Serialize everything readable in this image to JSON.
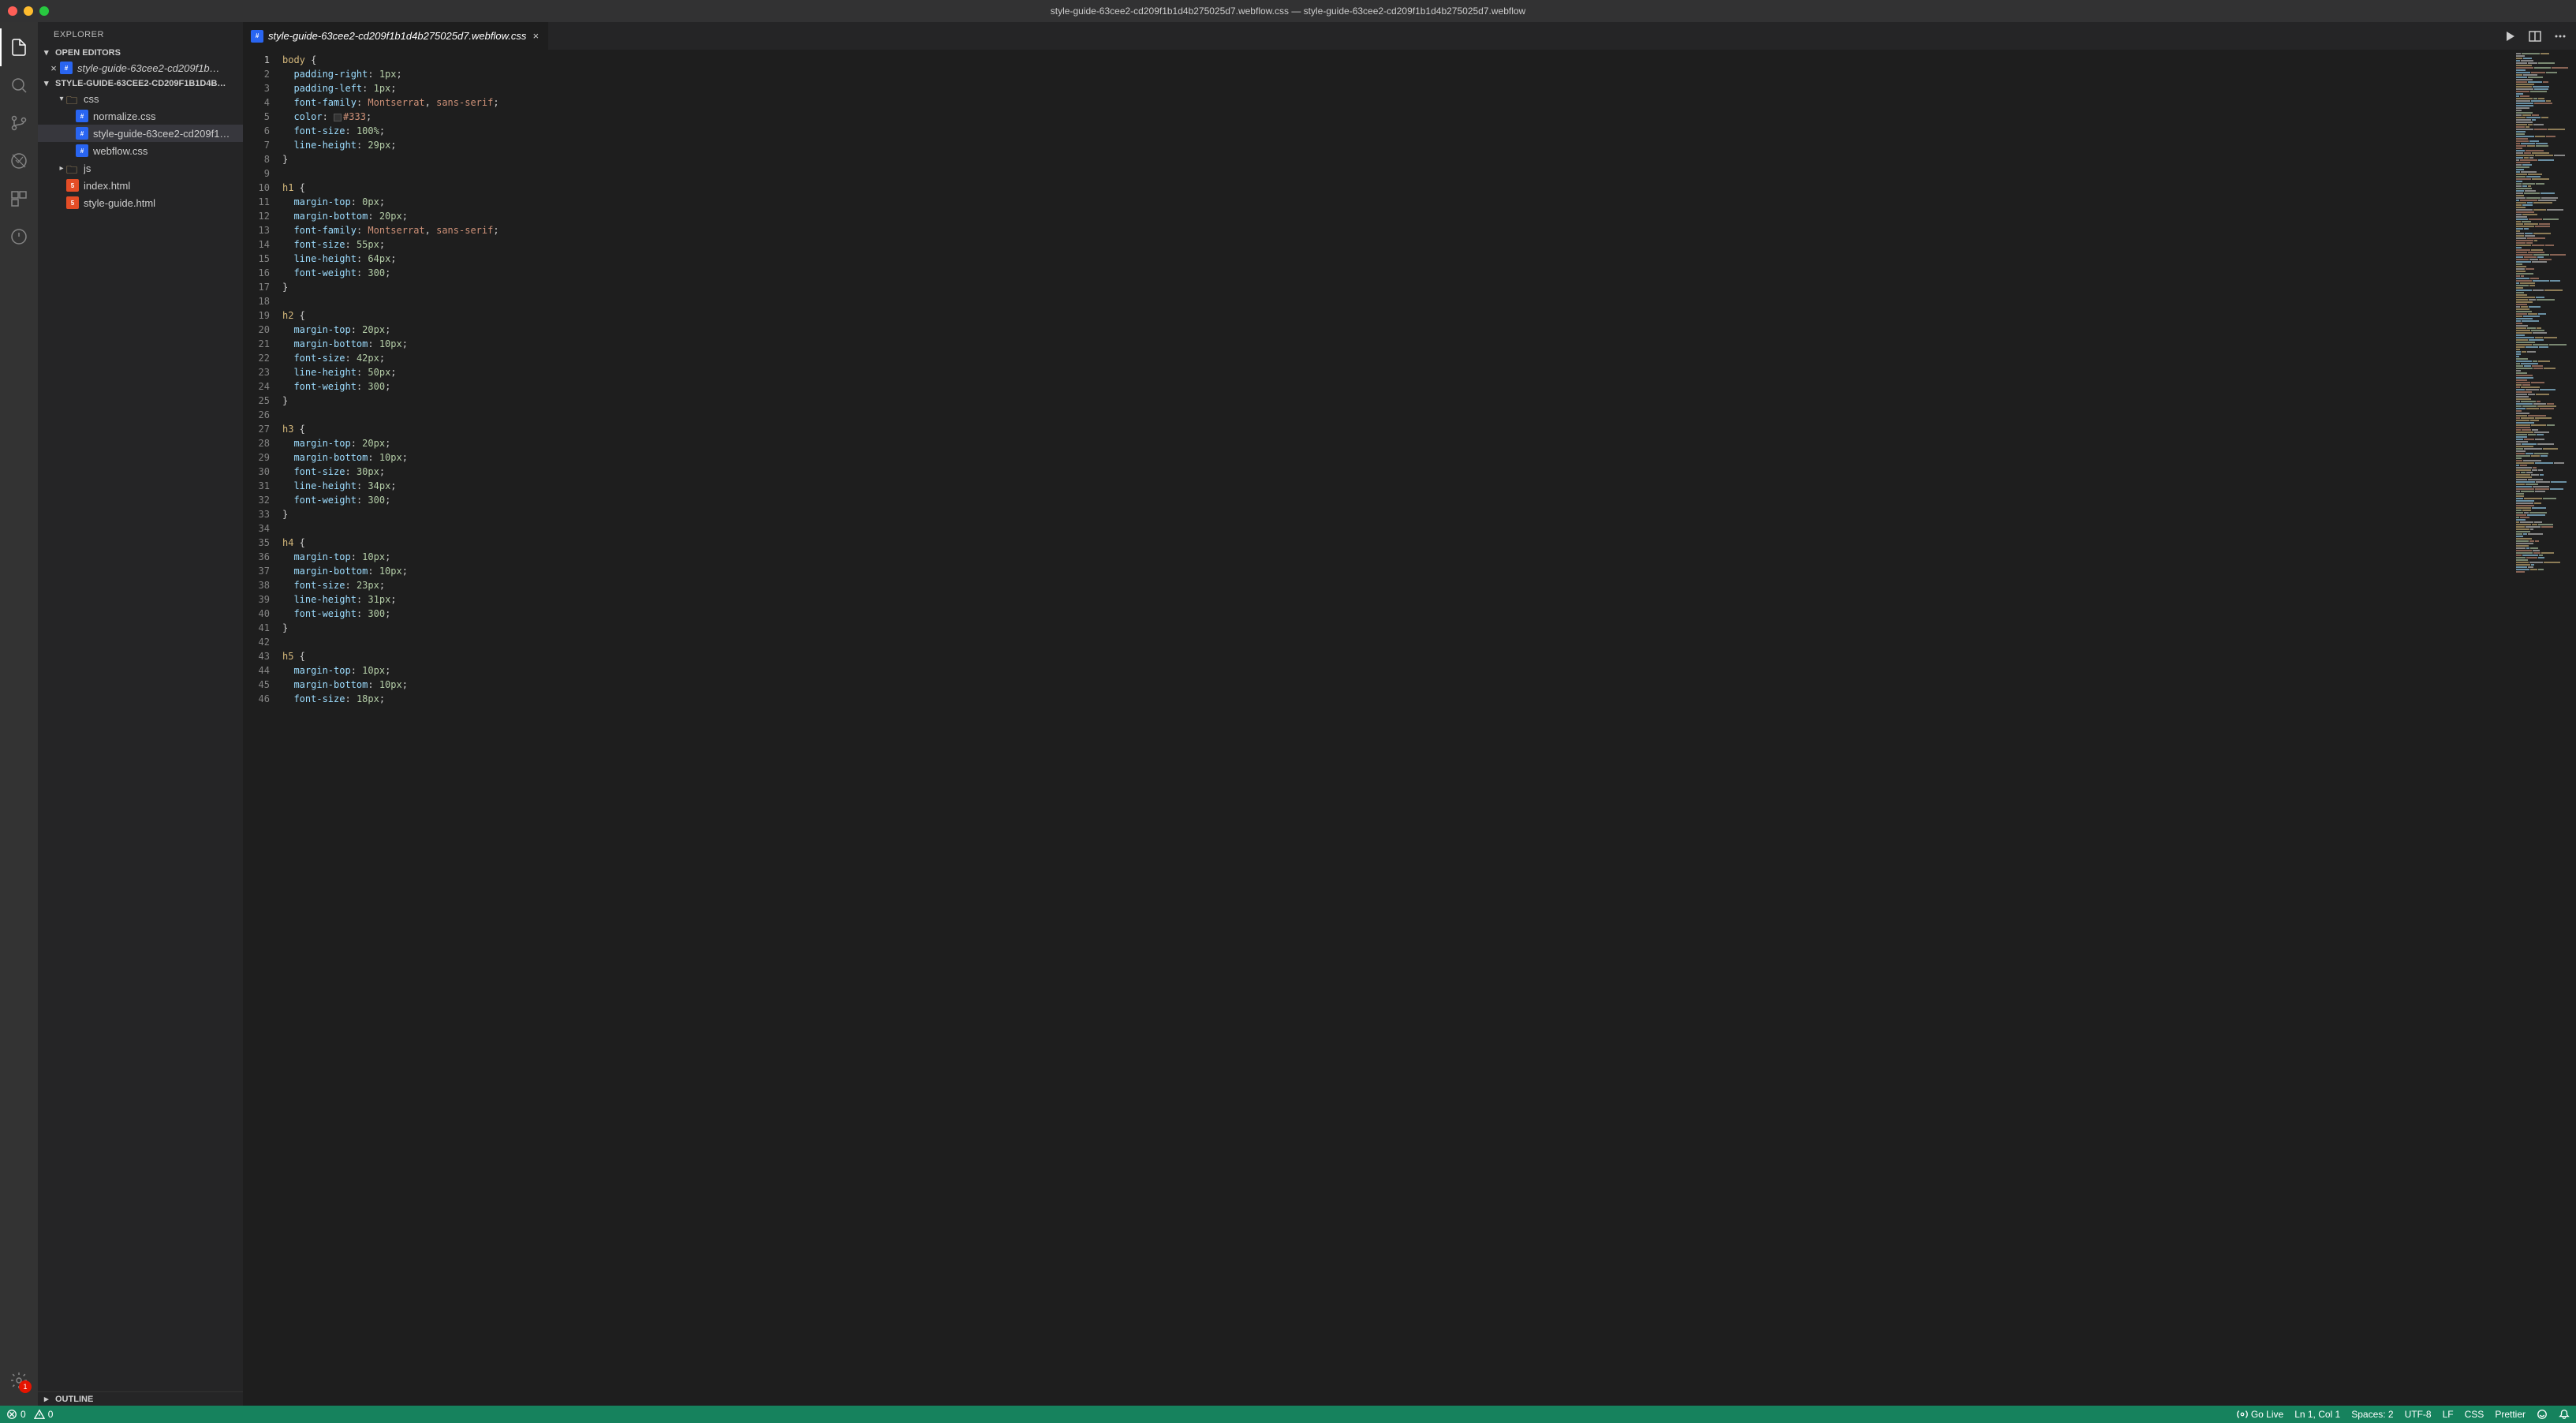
{
  "title": "style-guide-63cee2-cd209f1b1d4b275025d7.webflow.css — style-guide-63cee2-cd209f1b1d4b275025d7.webflow",
  "explorer": {
    "title": "EXPLORER",
    "openEditors": "OPEN EDITORS",
    "workspace": "STYLE-GUIDE-63CEE2-CD209F1B1D4B…",
    "outline": "OUTLINE",
    "openFile": "style-guide-63cee2-cd209f1b…",
    "tree": {
      "cssFolder": "css",
      "normalize": "normalize.css",
      "styleguide": "style-guide-63cee2-cd209f1…",
      "webflow": "webflow.css",
      "jsFolder": "js",
      "indexHtml": "index.html",
      "styleGuideHtml": "style-guide.html"
    }
  },
  "tab": {
    "name": "style-guide-63cee2-cd209f1b1d4b275025d7.webflow.css"
  },
  "code": [
    [
      [
        "sel",
        "body"
      ],
      [
        "punc",
        " {"
      ]
    ],
    [
      [
        "indent",
        "  "
      ],
      [
        "prop",
        "padding-right"
      ],
      [
        "punc",
        ": "
      ],
      [
        "num",
        "1px"
      ],
      [
        "punc",
        ";"
      ]
    ],
    [
      [
        "indent",
        "  "
      ],
      [
        "prop",
        "padding-left"
      ],
      [
        "punc",
        ": "
      ],
      [
        "num",
        "1px"
      ],
      [
        "punc",
        ";"
      ]
    ],
    [
      [
        "indent",
        "  "
      ],
      [
        "prop",
        "font-family"
      ],
      [
        "punc",
        ": "
      ],
      [
        "str",
        "Montserrat"
      ],
      [
        "punc",
        ", "
      ],
      [
        "str",
        "sans-serif"
      ],
      [
        "punc",
        ";"
      ]
    ],
    [
      [
        "indent",
        "  "
      ],
      [
        "prop",
        "color"
      ],
      [
        "punc",
        ": "
      ],
      [
        "swatch",
        ""
      ],
      [
        "color",
        "#333"
      ],
      [
        "punc",
        ";"
      ]
    ],
    [
      [
        "indent",
        "  "
      ],
      [
        "prop",
        "font-size"
      ],
      [
        "punc",
        ": "
      ],
      [
        "num",
        "100%"
      ],
      [
        "punc",
        ";"
      ]
    ],
    [
      [
        "indent",
        "  "
      ],
      [
        "prop",
        "line-height"
      ],
      [
        "punc",
        ": "
      ],
      [
        "num",
        "29px"
      ],
      [
        "punc",
        ";"
      ]
    ],
    [
      [
        "punc",
        "}"
      ]
    ],
    [],
    [
      [
        "sel",
        "h1"
      ],
      [
        "punc",
        " {"
      ]
    ],
    [
      [
        "indent",
        "  "
      ],
      [
        "prop",
        "margin-top"
      ],
      [
        "punc",
        ": "
      ],
      [
        "num",
        "0px"
      ],
      [
        "punc",
        ";"
      ]
    ],
    [
      [
        "indent",
        "  "
      ],
      [
        "prop",
        "margin-bottom"
      ],
      [
        "punc",
        ": "
      ],
      [
        "num",
        "20px"
      ],
      [
        "punc",
        ";"
      ]
    ],
    [
      [
        "indent",
        "  "
      ],
      [
        "prop",
        "font-family"
      ],
      [
        "punc",
        ": "
      ],
      [
        "str",
        "Montserrat"
      ],
      [
        "punc",
        ", "
      ],
      [
        "str",
        "sans-serif"
      ],
      [
        "punc",
        ";"
      ]
    ],
    [
      [
        "indent",
        "  "
      ],
      [
        "prop",
        "font-size"
      ],
      [
        "punc",
        ": "
      ],
      [
        "num",
        "55px"
      ],
      [
        "punc",
        ";"
      ]
    ],
    [
      [
        "indent",
        "  "
      ],
      [
        "prop",
        "line-height"
      ],
      [
        "punc",
        ": "
      ],
      [
        "num",
        "64px"
      ],
      [
        "punc",
        ";"
      ]
    ],
    [
      [
        "indent",
        "  "
      ],
      [
        "prop",
        "font-weight"
      ],
      [
        "punc",
        ": "
      ],
      [
        "num",
        "300"
      ],
      [
        "punc",
        ";"
      ]
    ],
    [
      [
        "punc",
        "}"
      ]
    ],
    [],
    [
      [
        "sel",
        "h2"
      ],
      [
        "punc",
        " {"
      ]
    ],
    [
      [
        "indent",
        "  "
      ],
      [
        "prop",
        "margin-top"
      ],
      [
        "punc",
        ": "
      ],
      [
        "num",
        "20px"
      ],
      [
        "punc",
        ";"
      ]
    ],
    [
      [
        "indent",
        "  "
      ],
      [
        "prop",
        "margin-bottom"
      ],
      [
        "punc",
        ": "
      ],
      [
        "num",
        "10px"
      ],
      [
        "punc",
        ";"
      ]
    ],
    [
      [
        "indent",
        "  "
      ],
      [
        "prop",
        "font-size"
      ],
      [
        "punc",
        ": "
      ],
      [
        "num",
        "42px"
      ],
      [
        "punc",
        ";"
      ]
    ],
    [
      [
        "indent",
        "  "
      ],
      [
        "prop",
        "line-height"
      ],
      [
        "punc",
        ": "
      ],
      [
        "num",
        "50px"
      ],
      [
        "punc",
        ";"
      ]
    ],
    [
      [
        "indent",
        "  "
      ],
      [
        "prop",
        "font-weight"
      ],
      [
        "punc",
        ": "
      ],
      [
        "num",
        "300"
      ],
      [
        "punc",
        ";"
      ]
    ],
    [
      [
        "punc",
        "}"
      ]
    ],
    [],
    [
      [
        "sel",
        "h3"
      ],
      [
        "punc",
        " {"
      ]
    ],
    [
      [
        "indent",
        "  "
      ],
      [
        "prop",
        "margin-top"
      ],
      [
        "punc",
        ": "
      ],
      [
        "num",
        "20px"
      ],
      [
        "punc",
        ";"
      ]
    ],
    [
      [
        "indent",
        "  "
      ],
      [
        "prop",
        "margin-bottom"
      ],
      [
        "punc",
        ": "
      ],
      [
        "num",
        "10px"
      ],
      [
        "punc",
        ";"
      ]
    ],
    [
      [
        "indent",
        "  "
      ],
      [
        "prop",
        "font-size"
      ],
      [
        "punc",
        ": "
      ],
      [
        "num",
        "30px"
      ],
      [
        "punc",
        ";"
      ]
    ],
    [
      [
        "indent",
        "  "
      ],
      [
        "prop",
        "line-height"
      ],
      [
        "punc",
        ": "
      ],
      [
        "num",
        "34px"
      ],
      [
        "punc",
        ";"
      ]
    ],
    [
      [
        "indent",
        "  "
      ],
      [
        "prop",
        "font-weight"
      ],
      [
        "punc",
        ": "
      ],
      [
        "num",
        "300"
      ],
      [
        "punc",
        ";"
      ]
    ],
    [
      [
        "punc",
        "}"
      ]
    ],
    [],
    [
      [
        "sel",
        "h4"
      ],
      [
        "punc",
        " {"
      ]
    ],
    [
      [
        "indent",
        "  "
      ],
      [
        "prop",
        "margin-top"
      ],
      [
        "punc",
        ": "
      ],
      [
        "num",
        "10px"
      ],
      [
        "punc",
        ";"
      ]
    ],
    [
      [
        "indent",
        "  "
      ],
      [
        "prop",
        "margin-bottom"
      ],
      [
        "punc",
        ": "
      ],
      [
        "num",
        "10px"
      ],
      [
        "punc",
        ";"
      ]
    ],
    [
      [
        "indent",
        "  "
      ],
      [
        "prop",
        "font-size"
      ],
      [
        "punc",
        ": "
      ],
      [
        "num",
        "23px"
      ],
      [
        "punc",
        ";"
      ]
    ],
    [
      [
        "indent",
        "  "
      ],
      [
        "prop",
        "line-height"
      ],
      [
        "punc",
        ": "
      ],
      [
        "num",
        "31px"
      ],
      [
        "punc",
        ";"
      ]
    ],
    [
      [
        "indent",
        "  "
      ],
      [
        "prop",
        "font-weight"
      ],
      [
        "punc",
        ": "
      ],
      [
        "num",
        "300"
      ],
      [
        "punc",
        ";"
      ]
    ],
    [
      [
        "punc",
        "}"
      ]
    ],
    [],
    [
      [
        "sel",
        "h5"
      ],
      [
        "punc",
        " {"
      ]
    ],
    [
      [
        "indent",
        "  "
      ],
      [
        "prop",
        "margin-top"
      ],
      [
        "punc",
        ": "
      ],
      [
        "num",
        "10px"
      ],
      [
        "punc",
        ";"
      ]
    ],
    [
      [
        "indent",
        "  "
      ],
      [
        "prop",
        "margin-bottom"
      ],
      [
        "punc",
        ": "
      ],
      [
        "num",
        "10px"
      ],
      [
        "punc",
        ";"
      ]
    ],
    [
      [
        "indent",
        "  "
      ],
      [
        "prop",
        "font-size"
      ],
      [
        "punc",
        ": "
      ],
      [
        "num",
        "18px"
      ],
      [
        "punc",
        ";"
      ]
    ]
  ],
  "status": {
    "errors": "0",
    "warnings": "0",
    "goLive": "Go Live",
    "lnCol": "Ln 1, Col 1",
    "spaces": "Spaces: 2",
    "encoding": "UTF-8",
    "eol": "LF",
    "lang": "CSS",
    "prettier": "Prettier",
    "gearBadge": "1"
  }
}
